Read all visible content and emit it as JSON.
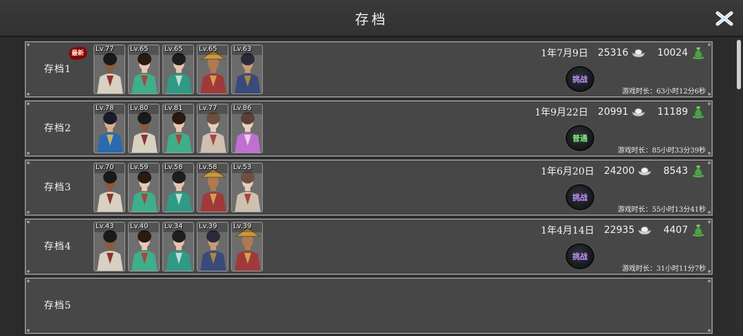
{
  "header": {
    "title": "存档"
  },
  "slots": [
    {
      "name": "存档1",
      "is_newest": true,
      "new_badge": "最新",
      "portraits": [
        {
          "level": "Lv.77",
          "character": "bearded-warrior"
        },
        {
          "level": "Lv.65",
          "character": "green-robed-lady"
        },
        {
          "level": "Lv.65",
          "character": "teal-robed-swordswoman"
        },
        {
          "level": "Lv.65",
          "character": "straw-hat-monk"
        },
        {
          "level": "Lv.63",
          "character": "armored-youth"
        }
      ],
      "date": "1年7月9日",
      "silver": "25316",
      "coins": "10024",
      "mode": "挑战",
      "mode_type": "challenge",
      "playtime": "游戏时长：63小时12分6秒"
    },
    {
      "name": "存档2",
      "is_newest": false,
      "portraits": [
        {
          "level": "Lv.78",
          "character": "blue-armored-youth"
        },
        {
          "level": "Lv.80",
          "character": "bearded-warrior"
        },
        {
          "level": "Lv.81",
          "character": "green-robed-lady"
        },
        {
          "level": "Lv.77",
          "character": "fan-maiden"
        },
        {
          "level": "Lv.86",
          "character": "purple-robed-maiden"
        }
      ],
      "date": "1年9月22日",
      "silver": "20991",
      "coins": "11189",
      "mode": "普通",
      "mode_type": "normal",
      "playtime": "游戏时长：85小时33分39秒"
    },
    {
      "name": "存档3",
      "is_newest": false,
      "portraits": [
        {
          "level": "Lv.70",
          "character": "bearded-warrior"
        },
        {
          "level": "Lv.59",
          "character": "green-robed-lady"
        },
        {
          "level": "Lv.58",
          "character": "teal-robed-swordswoman"
        },
        {
          "level": "Lv.58",
          "character": "straw-hat-monk"
        },
        {
          "level": "Lv.53",
          "character": "fan-maiden"
        }
      ],
      "date": "1年6月20日",
      "silver": "24200",
      "coins": "8543",
      "mode": "挑战",
      "mode_type": "challenge",
      "playtime": "游戏时长：55小时13分41秒"
    },
    {
      "name": "存档4",
      "is_newest": false,
      "portraits": [
        {
          "level": "Lv.43",
          "character": "bearded-warrior"
        },
        {
          "level": "Lv.40",
          "character": "green-robed-lady"
        },
        {
          "level": "Lv.34",
          "character": "teal-robed-swordswoman"
        },
        {
          "level": "Lv.39",
          "character": "armored-youth"
        },
        {
          "level": "Lv.39",
          "character": "straw-hat-monk"
        }
      ],
      "date": "1年4月14日",
      "silver": "22935",
      "coins": "4407",
      "mode": "挑战",
      "mode_type": "challenge",
      "playtime": "游戏时长：31小时11分7秒"
    },
    {
      "name": "存档5",
      "is_newest": false,
      "empty": true,
      "portraits": []
    }
  ],
  "icons": {
    "close": "close-x-icon",
    "silver": "silver-ingot-icon",
    "coins": "coin-jar-icon"
  },
  "colors": {
    "challenge": "#c792ff",
    "normal": "#7ff07f",
    "badge": "#8b0000"
  }
}
